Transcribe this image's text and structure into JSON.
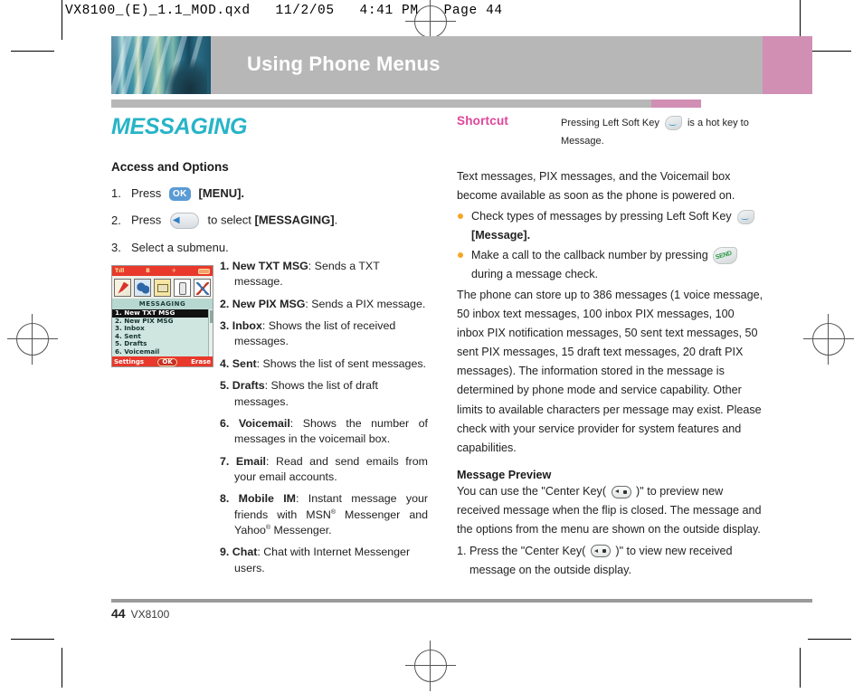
{
  "print_header": "VX8100_(E)_1.1_MOD.qxd   11/2/05   4:41 PM   Page 44",
  "header": {
    "title": "Using Phone Menus",
    "accent_gray": "#b7b7b7",
    "accent_pink": "#d18fb4"
  },
  "chapter": {
    "title": "MESSAGING",
    "color": "#27b4c8",
    "subhead": "Access and Options"
  },
  "steps": [
    {
      "num": "1.",
      "verb": "Press",
      "key": "ok-key",
      "tail": "[MENU]."
    },
    {
      "num": "2.",
      "verb": "Press",
      "key": "nav-left-key",
      "tail": "to select [MESSAGING]."
    },
    {
      "num": "3.",
      "verb": "Select a submenu.",
      "key": "",
      "tail": ""
    }
  ],
  "phone_screen": {
    "status_left": "Tıll",
    "status_mid": "B",
    "status_mid2": "✛",
    "title": "MESSAGING",
    "items": [
      {
        "label": "1. New TXT MSG",
        "selected": true
      },
      {
        "label": "2. New PIX MSG",
        "selected": false
      },
      {
        "label": "3. Inbox",
        "selected": false
      },
      {
        "label": "4. Sent",
        "selected": false
      },
      {
        "label": "5. Drafts",
        "selected": false
      },
      {
        "label": "6. Voicemail",
        "selected": false
      }
    ],
    "soft_left": "Settings",
    "soft_center": "OK",
    "soft_right": "Erase"
  },
  "submenu_definitions": [
    {
      "num": "1.",
      "term": "New TXT MSG",
      "desc": ": Sends a TXT message."
    },
    {
      "num": "2.",
      "term": "New PIX MSG",
      "desc": ": Sends a PIX message."
    },
    {
      "num": "3.",
      "term": "Inbox",
      "desc": ": Shows the list of received messages."
    },
    {
      "num": "4.",
      "term": "Sent",
      "desc": ": Shows the list of sent messages."
    },
    {
      "num": "5.",
      "term": "Drafts",
      "desc": ": Shows the list of draft messages."
    },
    {
      "num": "6.",
      "term": "Voicemail",
      "desc": ": Shows the number of messages in the voicemail box."
    },
    {
      "num": "7.",
      "term": "Email",
      "desc": ": Read and send emails from your email accounts."
    },
    {
      "num": "8.",
      "term": "Mobile IM",
      "desc": ": Instant message your friends with MSN® Messenger and Yahoo® Messenger."
    },
    {
      "num": "9.",
      "term": "Chat",
      "desc": ": Chat with Internet Messenger users."
    }
  ],
  "shortcut": {
    "label": "Shortcut",
    "text_before": "Pressing Left Soft Key",
    "text_after": "is a hot key to Message."
  },
  "right_column": {
    "intro": "Text messages, PIX messages, and the Voicemail box become available as soon as the phone is powered on.",
    "bullet1_before": "Check types of messages by pressing Left Soft Key",
    "bullet1_after": "[Message].",
    "bullet2_before": "Make a call to the callback number by pressing",
    "bullet2_after": "during a message check.",
    "capacity_para": "The phone can store up to 386 messages (1 voice message, 50 inbox text messages, 100 inbox PIX messages, 100 inbox PIX notification messages, 50 sent text messages, 50 sent PIX messages, 15 draft text messages, 20 draft PIX messages). The information stored in the message is determined by phone mode and service capability. Other limits to available characters per message may exist. Please check with your service provider for system features and capabilities.",
    "preview_head": "Message Preview",
    "preview_before": "You can use the \"Center Key(",
    "preview_after": ")\" to preview new received message when the flip is closed. The message and the options from the menu are shown on the outside display.",
    "preview_step_num": "1.",
    "preview_step_before": "Press the \"Center Key(",
    "preview_step_after": ")\" to view new received message on the outside display."
  },
  "footer": {
    "page_number": "44",
    "model": "VX8100"
  }
}
